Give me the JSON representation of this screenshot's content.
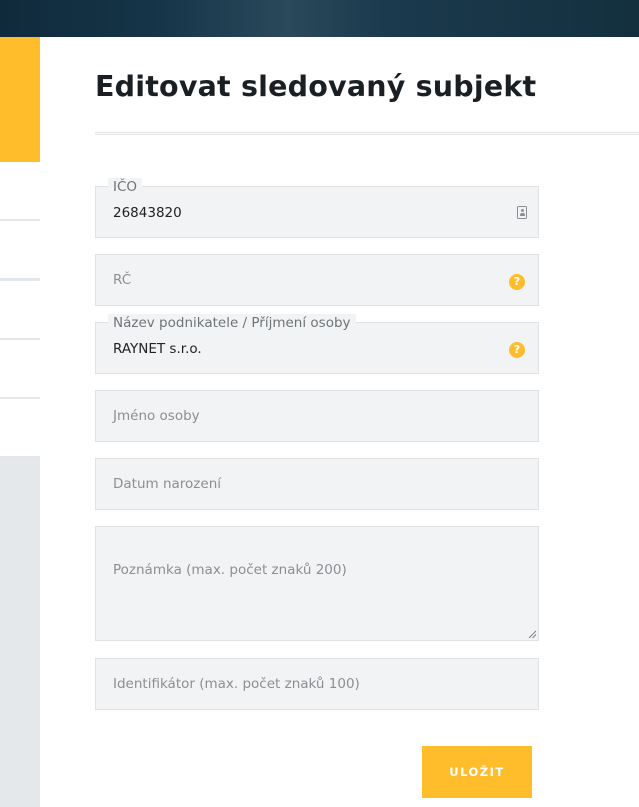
{
  "page": {
    "title": "Editovat sledovaný subjekt"
  },
  "form": {
    "ico": {
      "label": "IČO",
      "value": "26843820"
    },
    "rc": {
      "placeholder": "RČ"
    },
    "nazev": {
      "label": "Název podnikatele / Příjmení osoby",
      "value": "RAYNET s.r.o."
    },
    "jmeno": {
      "placeholder": "Jméno osoby"
    },
    "datum": {
      "placeholder": "Datum narození"
    },
    "poznamka": {
      "placeholder": "Poznámka (max. počet znaků 200)"
    },
    "identifikator": {
      "placeholder": "Identifikátor (max. počet znaků 100)"
    },
    "help_glyph": "?",
    "save_label": "ULOŽIT"
  },
  "icons": {
    "ico_field": "id-card-icon",
    "help": "question-circle-icon",
    "textarea": "resize-grip-icon"
  },
  "colors": {
    "accent": "#ffbd2c",
    "field_bg": "#f2f3f4",
    "title": "#1a1f24",
    "topbar": "#0f2a3b",
    "sidebar": "#e5e8eb"
  }
}
